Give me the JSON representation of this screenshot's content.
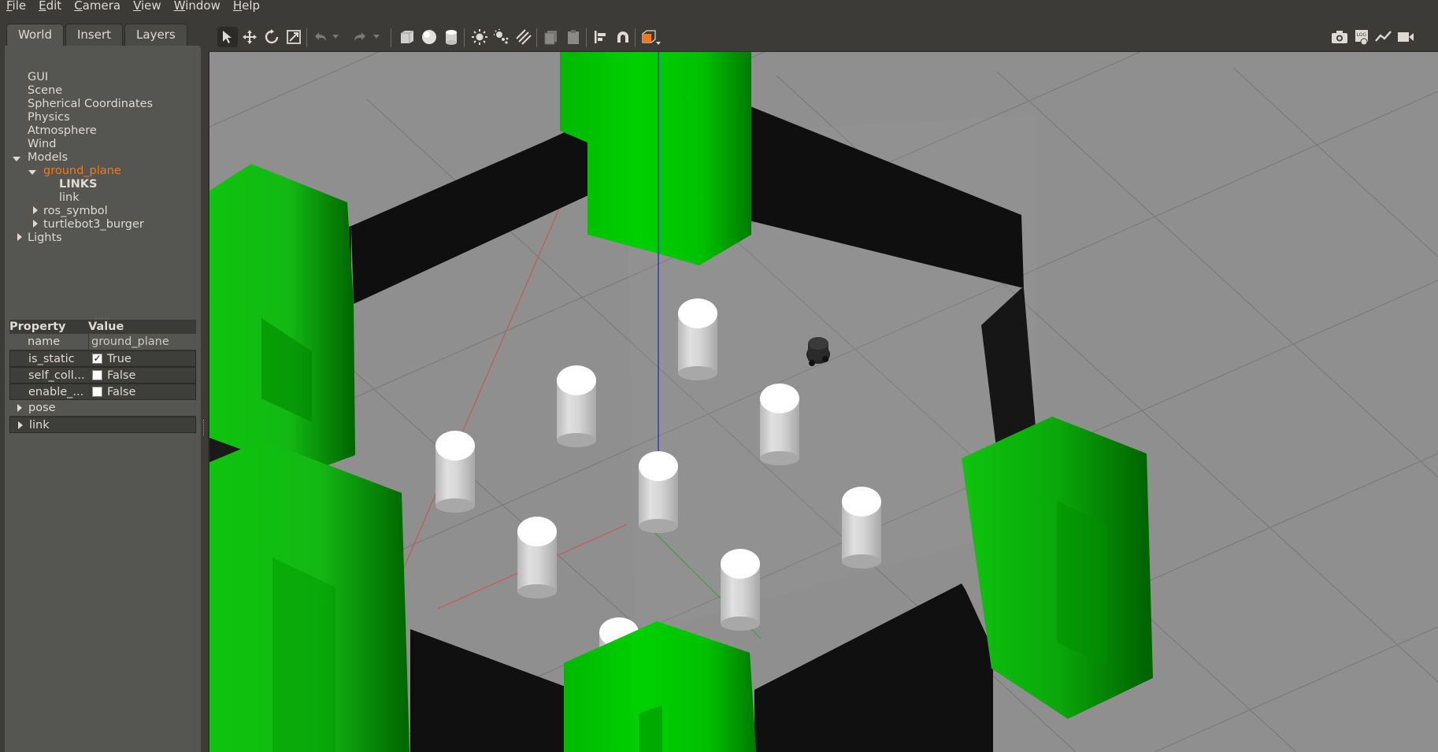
{
  "menubar": {
    "items": [
      {
        "label": "File",
        "mnemonic": "F",
        "rest": "ile"
      },
      {
        "label": "Edit",
        "mnemonic": "E",
        "rest": "dit"
      },
      {
        "label": "Camera",
        "mnemonic": "C",
        "rest": "amera"
      },
      {
        "label": "View",
        "mnemonic": "V",
        "rest": "iew"
      },
      {
        "label": "Window",
        "mnemonic": "W",
        "rest": "indow"
      },
      {
        "label": "Help",
        "mnemonic": "H",
        "rest": "elp"
      }
    ]
  },
  "tabs": [
    "World",
    "Insert",
    "Layers"
  ],
  "tree": {
    "gui": "GUI",
    "scene": "Scene",
    "spherical": "Spherical Coordinates",
    "physics": "Physics",
    "atmosphere": "Atmosphere",
    "wind": "Wind",
    "models": "Models",
    "ground_plane": "ground_plane",
    "links": "LINKS",
    "link": "link",
    "ros_symbol": "ros_symbol",
    "turtlebot": "turtlebot3_burger",
    "lights": "Lights"
  },
  "properties": {
    "header_property": "Property",
    "header_value": "Value",
    "rows": [
      {
        "name": "name",
        "value": "ground_plane"
      },
      {
        "name": "is_static",
        "value": "True",
        "checked": true
      },
      {
        "name": "self_coll...",
        "value": "False",
        "checked": false
      },
      {
        "name": "enable_...",
        "value": "False",
        "checked": false
      }
    ],
    "pose": "pose",
    "link": "link"
  },
  "colors": {
    "selected": "#f07a1b",
    "green": "#0ec40e",
    "darkgreen": "#007a00",
    "wall": "#111111",
    "ground": "#8f8f8f",
    "accent_orange": "#f07a1b"
  },
  "toolbar": {
    "icons": [
      "select-arrow-icon",
      "translate-icon",
      "rotate-icon",
      "scale-icon",
      "undo-icon",
      "undo-dropdown-icon",
      "redo-icon",
      "redo-dropdown-icon",
      "box-shape-icon",
      "sphere-shape-icon",
      "cylinder-shape-icon",
      "point-light-icon",
      "spot-light-icon",
      "directional-light-icon",
      "copy-icon",
      "paste-icon",
      "align-icon",
      "snap-magnet-icon",
      "view-angle-icon",
      "screenshot-camera-icon",
      "log-icon",
      "plot-icon",
      "video-record-icon"
    ]
  }
}
